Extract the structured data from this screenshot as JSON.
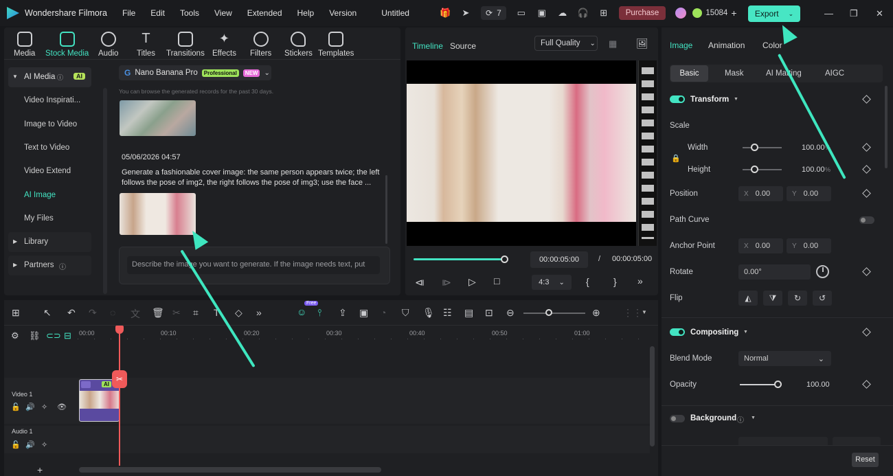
{
  "app": {
    "name": "Wondershare Filmora",
    "project": "Untitled"
  },
  "menu": [
    "File",
    "Edit",
    "Tools",
    "View",
    "Extended",
    "Help",
    "Version"
  ],
  "titlebar": {
    "notif_count": "7",
    "purchase": "Purchase",
    "credits": "15084",
    "export": "Export"
  },
  "media_tabs": [
    "Media",
    "Stock Media",
    "Audio",
    "Titles",
    "Transitions",
    "Effects",
    "Filters",
    "Stickers",
    "Templates"
  ],
  "sidebar": {
    "ai_media": "AI Media",
    "ai_badge": "AI",
    "items": [
      "Video Inspirati...",
      "Image to Video",
      "Text to Video",
      "Video Extend",
      "AI Image",
      "My Files"
    ],
    "library": "Library",
    "partners": "Partners"
  },
  "generator": {
    "model": "Nano Banana Pro",
    "badge_pro": "Professional",
    "badge_new": "NEW",
    "hint": "You can browse the generated records for the past 30 days.",
    "record_date": "05/06/2026 04:57",
    "record_prompt": "Generate a fashionable cover image: the same person appears twice; the left follows the pose of img2, the right follows the pose of img3; use the face ...",
    "input_placeholder": "Describe the image you want to generate. If the image needs text, put"
  },
  "preview": {
    "tab_timeline": "Timeline",
    "tab_source": "Source",
    "quality": "Full Quality",
    "time_current": "00:00:05:00",
    "time_sep": "/",
    "time_total": "00:00:05:00",
    "aspect": "4:3",
    "progress": 1.0
  },
  "timeline": {
    "free_badge": "Free",
    "ruler": [
      "00:00",
      "00:10",
      "00:20",
      "00:30",
      "00:40",
      "00:50",
      "01:00"
    ],
    "video_track": "Video 1",
    "audio_track": "Audio 1",
    "clip_badge": "AI"
  },
  "right_panel": {
    "tabs": [
      "Image",
      "Animation",
      "Color"
    ],
    "subtabs": [
      "Basic",
      "Mask",
      "AI Matting",
      "AIGC"
    ],
    "transform": "Transform",
    "scale": "Scale",
    "width": "Width",
    "width_val": "100.00",
    "height": "Height",
    "height_val": "100.00",
    "pct": "%",
    "position": "Position",
    "pos_x_axis": "X",
    "pos_x": "0.00",
    "pos_y_axis": "Y",
    "pos_y": "0.00",
    "path_curve": "Path Curve",
    "anchor_point": "Anchor Point",
    "anchor_x": "0.00",
    "anchor_y": "0.00",
    "rotate": "Rotate",
    "rotate_val": "0.00°",
    "flip": "Flip",
    "compositing": "Compositing",
    "blend_mode": "Blend Mode",
    "blend_val": "Normal",
    "opacity": "Opacity",
    "opacity_val": "100.00",
    "background": "Background",
    "reset": "Reset"
  },
  "colors": {
    "accent": "#43e3c2",
    "playhead": "#f05a5a",
    "bg": "#17181b",
    "panel": "#1f2023"
  }
}
